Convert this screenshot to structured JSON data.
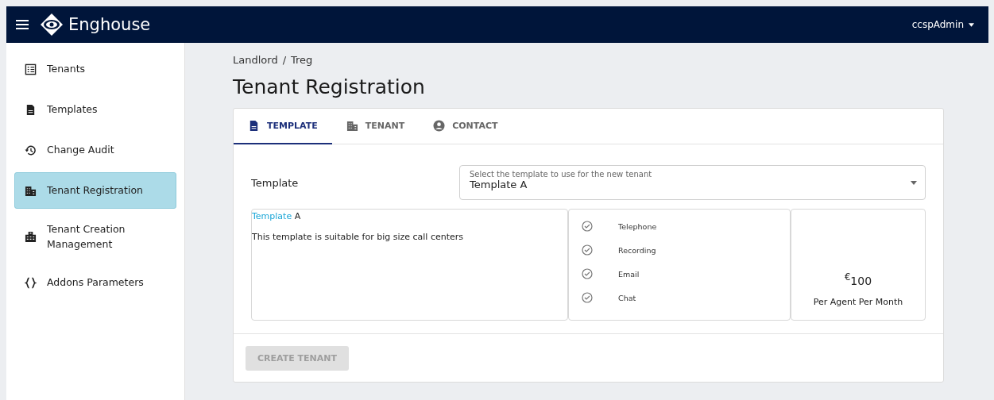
{
  "header": {
    "brand": "Enghouse",
    "user": "ccspAdmin"
  },
  "sidebar": {
    "items": [
      {
        "label": "Tenants",
        "selected": false
      },
      {
        "label": "Templates",
        "selected": false
      },
      {
        "label": "Change Audit",
        "selected": false
      },
      {
        "label": "Tenant Registration",
        "selected": true
      },
      {
        "label": "Tenant Creation Management",
        "selected": false
      },
      {
        "label": "Addons Parameters",
        "selected": false
      }
    ]
  },
  "breadcrumb": [
    "Landlord",
    "/",
    "Treg"
  ],
  "page_title": "Tenant Registration",
  "tabs": [
    {
      "label": "TEMPLATE",
      "selected": true
    },
    {
      "label": "TENANT",
      "selected": false
    },
    {
      "label": "CONTACT",
      "selected": false
    }
  ],
  "template_field": {
    "label": "Template",
    "floating_label": "Select the template to use for the new tenant",
    "value": "Template A"
  },
  "template_card": {
    "title_link": "Template",
    "title_rest": "A",
    "description": "This template is suitable for big size call centers"
  },
  "features": [
    {
      "label": "Telephone",
      "checked": true
    },
    {
      "label": "Recording",
      "checked": true
    },
    {
      "label": "Email",
      "checked": true
    },
    {
      "label": "Chat",
      "checked": true
    }
  ],
  "price": {
    "amount": "$^{€}$100",
    "period": "Per Agent Per Month"
  },
  "create_button": {
    "label": "CREATE TENANT",
    "disabled": true
  }
}
